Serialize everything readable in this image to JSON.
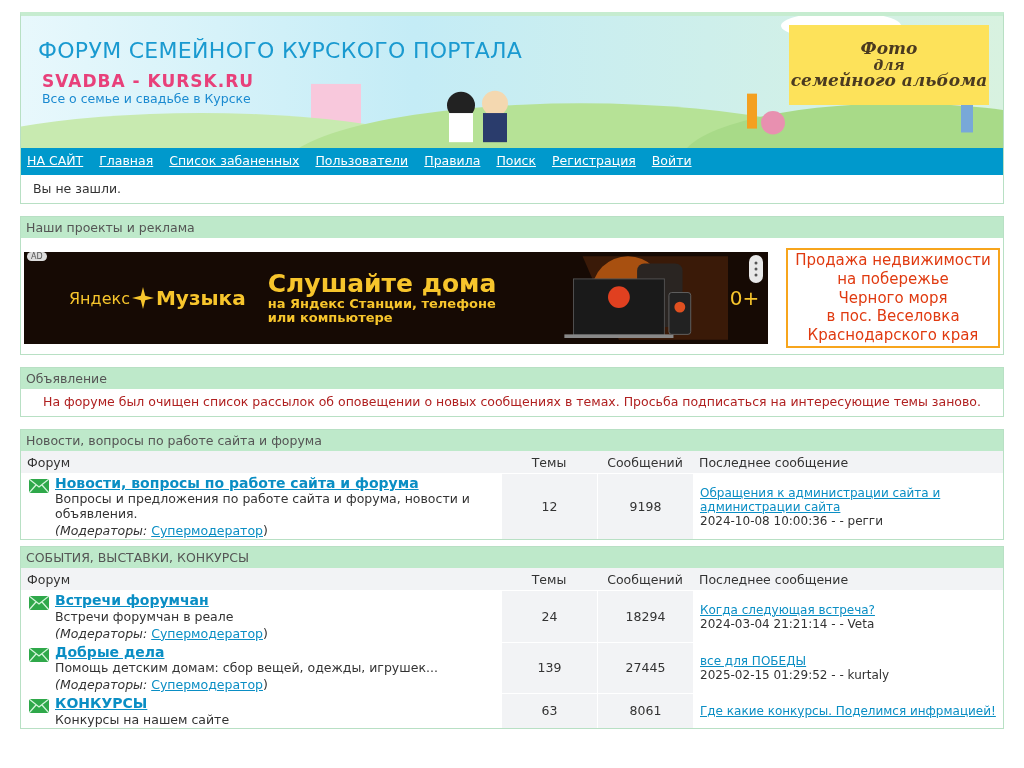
{
  "header": {
    "title": "ФОРУМ СЕМЕЙНОГО КУРСКОГО ПОРТАЛА",
    "logo": "SVADBA - KURSK.RU",
    "tagline": "Все о семье и свадьбе в Курске",
    "promo": [
      "Фото",
      "для",
      "семейного альбома"
    ]
  },
  "nav": [
    "НА САЙТ",
    "Главная",
    "Список забаненных",
    "Пользователи",
    "Правила",
    "Поиск",
    "Регистрация",
    "Войти"
  ],
  "login_status": "Вы не зашли.",
  "ads": {
    "title": "Наши проекты и реклама",
    "banner": {
      "badge": "AD",
      "brand_left": "Яндекс",
      "brand_right": "Музыка",
      "headline": "Слушайте дома",
      "subline": "на Яндекс Станции, телефоне или компьютере",
      "age": "0+"
    },
    "side_ad": [
      "Продажа недвижимости",
      "на побережье",
      "Черного моря",
      "в пос. Веселовка",
      "Краснодарского края"
    ]
  },
  "announcement": {
    "title": "Объявление",
    "text": "На форуме был очищен список рассылок об оповещении о новых сообщениях в темах. Просьба подписаться на интересующие темы заново."
  },
  "categories": [
    {
      "title": "Новости, вопросы по работе сайта и форума",
      "columns": [
        "Форум",
        "Темы",
        "Сообщений",
        "Последнее сообщение"
      ],
      "forums": [
        {
          "name": "Новости, вопросы по работе сайта и форума",
          "description": "Вопросы и предложения по работе сайта и форума, новости и объявления.",
          "moderators_prefix": "(Модераторы:",
          "moderator": "Супермодератор",
          "moderators_suffix": ")",
          "topics": "12",
          "posts": "9198",
          "last_post": {
            "title": "Обращения к администрации сайта и администрации сайта",
            "meta": "2024-10-08 10:00:36 - - регги"
          }
        }
      ]
    },
    {
      "title": "СОБЫТИЯ, ВЫСТАВКИ, КОНКУРСЫ",
      "columns": [
        "Форум",
        "Темы",
        "Сообщений",
        "Последнее сообщение"
      ],
      "forums": [
        {
          "name": "Встречи форумчан",
          "description": "Встречи форумчан в реале",
          "moderators_prefix": "(Модераторы:",
          "moderator": "Супермодератор",
          "moderators_suffix": ")",
          "topics": "24",
          "posts": "18294",
          "last_post": {
            "title": "Когда следующая встреча?",
            "meta": "2024-03-04 21:21:14 - - Veta"
          }
        },
        {
          "name": "Добрые дела",
          "description": "Помощь детским домам: сбор вещей, одежды, игрушек...",
          "moderators_prefix": "(Модераторы:",
          "moderator": "Супермодератор",
          "moderators_suffix": ")",
          "topics": "139",
          "posts": "27445",
          "last_post": {
            "title": "все для ПОБЕДЫ",
            "meta": "2025-02-15 01:29:52 - - kurtaly"
          }
        },
        {
          "name": "КОНКУРСЫ",
          "description": "Конкурсы на нашем сайте",
          "topics": "63",
          "posts": "8061",
          "last_post": {
            "title": "Где какие конкурсы. Поделимся инфрмацией!"
          }
        }
      ]
    }
  ]
}
